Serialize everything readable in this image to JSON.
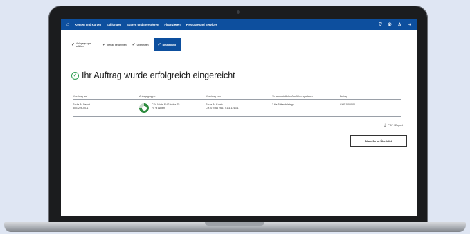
{
  "nav": {
    "items": [
      "Konten und Karten",
      "Zahlungen",
      "Sparen und Investieren",
      "Finanzieren",
      "Produkte und Services"
    ],
    "icons": [
      "shield-icon",
      "phone-icon",
      "user-icon",
      "logout-icon"
    ]
  },
  "stepper": {
    "steps": [
      {
        "label": "Anlagegruppe wählen",
        "active": false
      },
      {
        "label": "Betrag bestimmen",
        "active": false
      },
      {
        "label": "Überprüfen",
        "active": false
      },
      {
        "label": "Bestätigung",
        "active": true
      }
    ]
  },
  "confirmation": {
    "headline": "Ihr Auftrag wurde erfolgreich eingereicht"
  },
  "table": {
    "headers": [
      "Übertrag auf",
      "Anlagegruppe",
      "Übertrag von",
      "Voraussichtliche Ausführungsdauer",
      "Betrag"
    ],
    "row": {
      "to_line1": "Säule 3a Depot",
      "to_line2": "8001226-00-1",
      "group_line1": "CSA Mixta-BVG Index 75",
      "group_line2": "75 % Aktien",
      "from_line1": "Säule 3a Konto",
      "from_line2": "CH10 2466 7661 0111 1213 1",
      "duration": "3 bis 5 Handelstage",
      "amount": "CHF 1'000.00"
    },
    "equity_share_percent": 75
  },
  "actions": {
    "pdf_label": "PDF / Export",
    "back_button": "Säule 3a im Überblick"
  },
  "colors": {
    "brand": "#0d4f9e",
    "success": "#2e9d52",
    "donut": "#2e8b3f"
  }
}
